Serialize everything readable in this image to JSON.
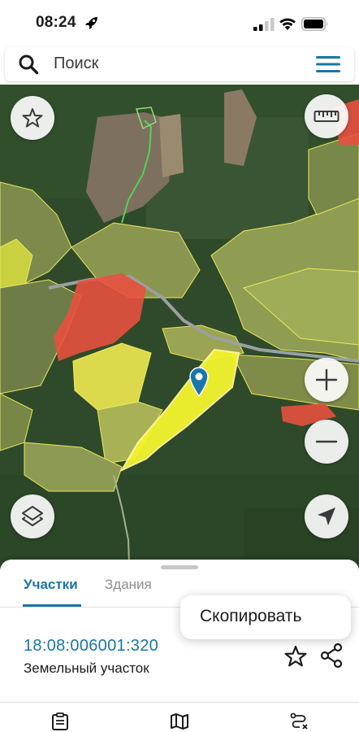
{
  "status_bar": {
    "time": "08:24"
  },
  "search": {
    "placeholder": "Поиск"
  },
  "map": {
    "selected_parcel_color": "#f4f42e",
    "buildings_color": "#e8503f",
    "boundary_color": "#e8e85a"
  },
  "tabs": [
    {
      "label": "Участки",
      "active": true
    },
    {
      "label": "Здания",
      "active": false
    }
  ],
  "parcel": {
    "number": "18:08:006001:320",
    "type": "Земельный участок"
  },
  "copy_popup": {
    "label": "Скопировать"
  },
  "colors": {
    "accent": "#1976a8"
  },
  "icons": [
    "rocket-icon",
    "signal-icon",
    "wifi-icon",
    "battery-icon",
    "search-icon",
    "menu-icon",
    "star-icon",
    "ruler-icon",
    "zoom-in-icon",
    "zoom-out-icon",
    "layers-icon",
    "locate-icon",
    "share-icon",
    "list-icon",
    "map-icon",
    "route-icon",
    "pin-icon"
  ]
}
